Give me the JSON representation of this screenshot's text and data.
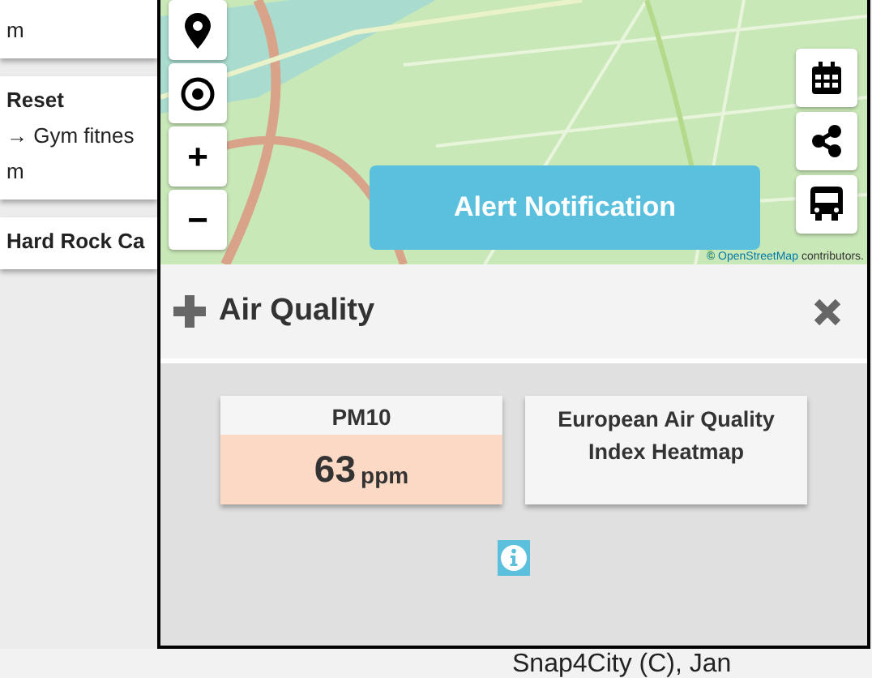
{
  "side_list": [
    {
      "lines": [
        "m"
      ]
    },
    {
      "title": "Reset",
      "lines": [
        "→ Gym fitnes",
        "m"
      ]
    },
    {
      "title": "Hard Rock Ca"
    }
  ],
  "map": {
    "left_controls": [
      {
        "kind": "marker"
      },
      {
        "kind": "locate"
      },
      {
        "kind": "text",
        "label": "+"
      },
      {
        "kind": "text",
        "label": "−"
      }
    ],
    "right_controls": [
      {
        "kind": "calendar"
      },
      {
        "kind": "share"
      },
      {
        "kind": "bus"
      }
    ],
    "alert_button": "Alert Notification",
    "attribution_link": "© OpenStreetMap",
    "attribution_text": "contributors."
  },
  "panel": {
    "title": "Air Quality",
    "tiles": [
      {
        "kind": "reading",
        "label": "PM10",
        "value": "63",
        "unit": "ppm"
      },
      {
        "kind": "link",
        "label": "European Air Quality Index Heatmap"
      }
    ]
  },
  "footer": "Snap4City (C), Jan"
}
